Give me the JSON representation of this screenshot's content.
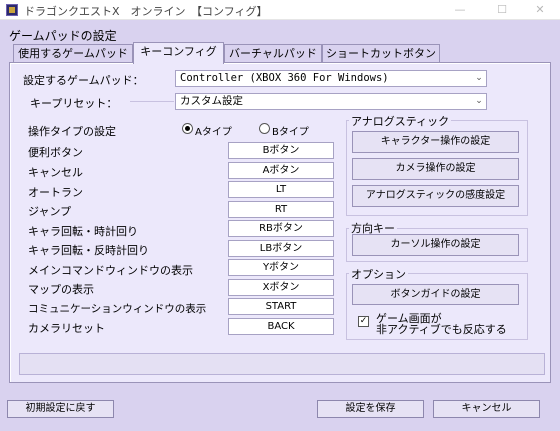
{
  "window": {
    "title": "ドラゴンクエストX　オンライン　【コンフィグ】",
    "minimize": "—",
    "maximize": "☐",
    "close": "✕"
  },
  "section_title": "ゲームパッドの設定",
  "tabs": [
    {
      "label": "使用するゲームパッド",
      "active": false
    },
    {
      "label": "キーコンフィグ",
      "active": true
    },
    {
      "label": "バーチャルパッド",
      "active": false
    },
    {
      "label": "ショートカットボタン",
      "active": false
    }
  ],
  "gamepad": {
    "label": "設定するゲームパッド：",
    "value": "Controller (XBOX 360 For Windows)"
  },
  "key_preset": {
    "label": "キープリセット：",
    "value": "カスタム設定"
  },
  "operation_type": {
    "label": "操作タイプの設定",
    "option_a": "Aタイプ",
    "option_b": "Bタイプ",
    "selected": "A"
  },
  "key_rows": [
    {
      "label": "便利ボタン",
      "value": "Bボタン"
    },
    {
      "label": "キャンセル",
      "value": "Aボタン"
    },
    {
      "label": "オートラン",
      "value": "LT"
    },
    {
      "label": "ジャンプ",
      "value": "RT"
    },
    {
      "label": "キャラ回転・時計回り",
      "value": "RBボタン"
    },
    {
      "label": "キャラ回転・反時計回り",
      "value": "LBボタン"
    },
    {
      "label": "メインコマンドウィンドウの表示",
      "value": "Yボタン"
    },
    {
      "label": "マップの表示",
      "value": "Xボタン"
    },
    {
      "label": "コミュニケーションウィンドウの表示",
      "value": "START"
    },
    {
      "label": "カメラリセット",
      "value": "BACK"
    }
  ],
  "analog": {
    "title": "アナログスティック",
    "character_btn": "キャラクター操作の設定",
    "camera_btn": "カメラ操作の設定",
    "sensitivity_btn": "アナログスティックの感度設定"
  },
  "direction": {
    "title": "方向キー",
    "cursor_btn": "カーソル操作の設定"
  },
  "options": {
    "title": "オプション",
    "guide_btn": "ボタンガイドの設定",
    "checkbox_line1": "ゲーム画面が",
    "checkbox_line2": "非アクティブでも反応する",
    "checked": true,
    "check_mark": "✓"
  },
  "footer": {
    "reset": "初期設定に戻す",
    "save": "設定を保存",
    "cancel": "キャンセル"
  }
}
